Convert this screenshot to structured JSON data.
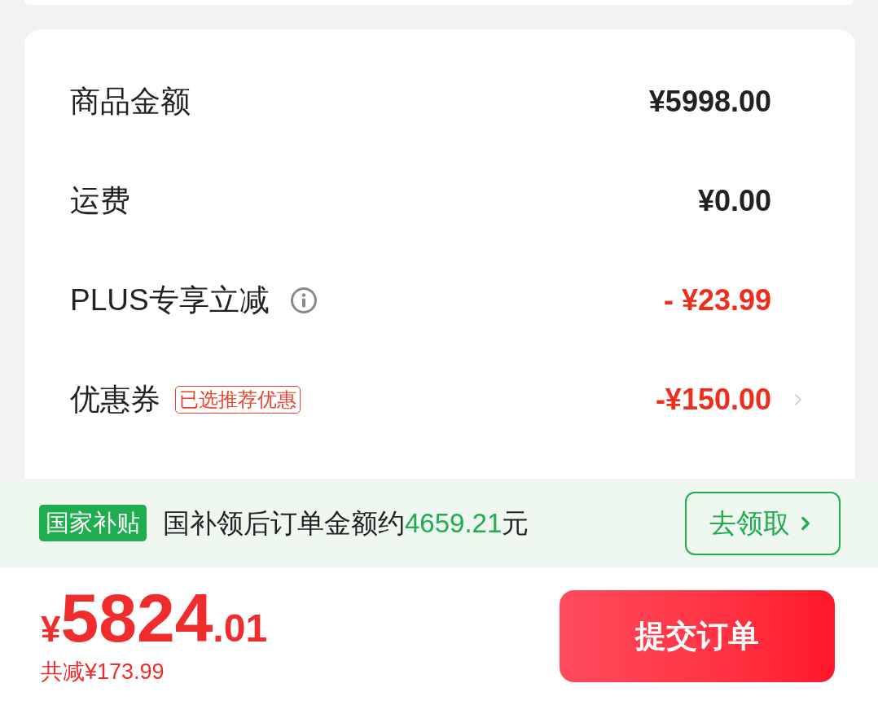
{
  "summary_rows": [
    {
      "kind": "plain",
      "label": "商品金额",
      "value": "¥5998.00",
      "discount": false
    },
    {
      "kind": "plain",
      "label": "运费",
      "value": "¥0.00",
      "discount": false
    },
    {
      "kind": "info",
      "label": "PLUS专享立减",
      "value": "- ¥23.99",
      "discount": true
    },
    {
      "kind": "coupon",
      "label": "优惠券",
      "tag": "已选推荐优惠",
      "value": "-¥150.00",
      "discount": true
    }
  ],
  "subsidy_bar": {
    "badge": "国家补贴",
    "message": "国补领后订单金额约",
    "amount": "4659.21",
    "unit": "元",
    "button": "去领取"
  },
  "footer": {
    "currency": "¥",
    "price_integer": "5824",
    "price_decimal": ".01",
    "savings": "共减¥173.99",
    "submit": "提交订单"
  }
}
